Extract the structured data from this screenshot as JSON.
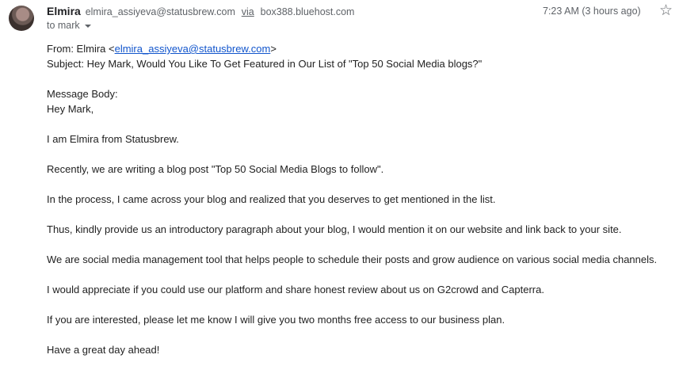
{
  "header": {
    "sender_name": "Elmira",
    "sender_email": "elmira_assiyeva@statusbrew.com",
    "via_label": "via",
    "via_host": "box388.bluehost.com",
    "to_label": "to mark",
    "time": "7:23 AM (3 hours ago)",
    "star_icon": "star-icon"
  },
  "body": {
    "from_prefix": "From: Elmira <",
    "from_email": "elmira_assiyeva@statusbrew.com",
    "from_suffix": ">",
    "subject": "Subject: Hey Mark, Would You Like To Get Featured in Our List of \"Top 50 Social Media blogs?\"",
    "message_label": "Message Body:",
    "greeting": "Hey Mark,",
    "p1": "I am Elmira from Statusbrew.",
    "p2": "Recently, we are writing a blog post \"Top 50 Social Media Blogs to follow\".",
    "p3": "In the process, I came across your blog and realized that you deserves to get mentioned in the list.",
    "p4": "Thus, kindly provide us an introductory paragraph about your blog, I would mention it on our website and link back to your site.",
    "p5": "We are social media management tool that helps people to schedule their posts and grow audience on various social media channels.",
    "p6": "I would appreciate if you could use our platform and share honest review about us on G2crowd and Capterra.",
    "p7": "If you are interested, please let me know I will give you two months free access to our business plan.",
    "p8": "Have a great day ahead!"
  }
}
